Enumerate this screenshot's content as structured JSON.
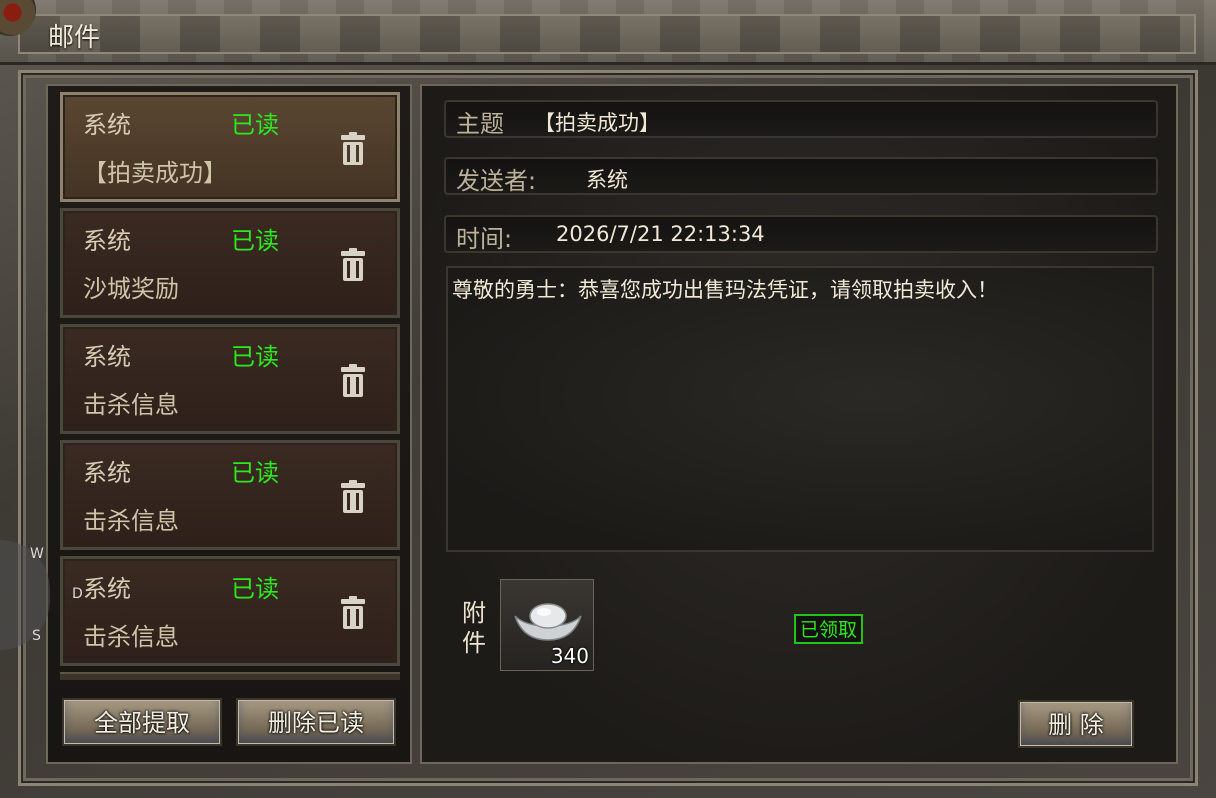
{
  "window": {
    "title": "邮件"
  },
  "mail_list": [
    {
      "sender": "系统",
      "status": "已读",
      "subject": "【拍卖成功】",
      "selected": true
    },
    {
      "sender": "系统",
      "status": "已读",
      "subject": "沙城奖励",
      "selected": false
    },
    {
      "sender": "系统",
      "status": "已读",
      "subject": "击杀信息",
      "selected": false
    },
    {
      "sender": "系统",
      "status": "已读",
      "subject": "击杀信息",
      "selected": false
    },
    {
      "sender": "系统",
      "status": "已读",
      "subject": "击杀信息",
      "selected": false
    }
  ],
  "list_buttons": {
    "claim_all": "全部提取",
    "delete_read": "删除已读"
  },
  "detail": {
    "subject_label": "主题",
    "subject_value": "【拍卖成功】",
    "sender_label": "发送者:",
    "sender_value": "系统",
    "time_label": "时间:",
    "time_value": "2026/7/21 22:13:34",
    "body": "尊敬的勇士：恭喜您成功出售玛法凭证，请领取拍卖收入！",
    "attachment_label": "附件",
    "attachment": {
      "icon": "silver-ingot-icon",
      "count": "340"
    },
    "claimed_status": "已领取",
    "delete_button": "删 除"
  },
  "side_hud": {
    "w": "W",
    "d": "D",
    "s": "S"
  },
  "colors": {
    "read_status": "#2ee81e",
    "claimed_border": "#22c41a"
  }
}
